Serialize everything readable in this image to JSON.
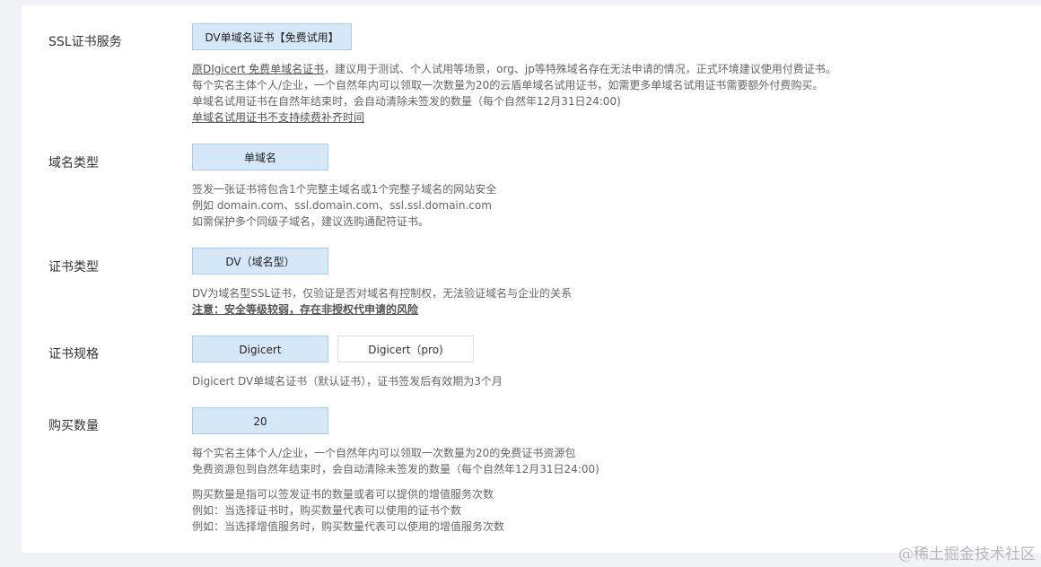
{
  "ssl": {
    "label": "SSL证书服务",
    "option": "DV单域名证书【免费试用】",
    "desc_link": "原DIgicert 免费单域名证书",
    "desc_line1_rest": "，建议用于测试、个人试用等场景，org、jp等特殊域名存在无法申请的情况，正式环境建议使用付费证书。",
    "desc_line2": "每个实名主体个人/企业，一个自然年内可以领取一次数量为20的云盾单域名试用证书，如需更多单域名试用证书需要额外付费购买。",
    "desc_line3": "单域名试用证书在自然年结束时，会自动清除未签发的数量（每个自然年12月31日24:00)",
    "desc_line4": "单域名试用证书不支持续费补齐时间"
  },
  "domain_type": {
    "label": "域名类型",
    "option": "单域名",
    "desc_lines": [
      "签发一张证书将包含1个完整主域名或1个完整子域名的网站安全",
      "例如 domain.com、ssl.domain.com、ssl.ssl.domain.com",
      "如需保护多个同级子域名，建议选购通配符证书。"
    ]
  },
  "cert_type": {
    "label": "证书类型",
    "option": "DV（域名型）",
    "desc_line1": "DV为域名型SSL证书，仅验证是否对域名有控制权，无法验证域名与企业的关系",
    "warning": "注意：安全等级较弱，存在非授权代申请的风险"
  },
  "spec": {
    "label": "证书规格",
    "options": [
      "Digicert",
      "Digicert（pro)"
    ],
    "desc_line1": "Digicert DV单域名证书（默认证书），证书签发后有效期为3个月"
  },
  "quantity": {
    "label": "购买数量",
    "value": "20",
    "desc_lines_a": [
      "每个实名主体个人/企业，一个自然年内可以领取一次数量为20的免费证书资源包",
      "免费资源包到自然年结束时，会自动清除未签发的数量（每个自然年12月31日24:00)"
    ],
    "desc_lines_b": [
      "购买数量是指可以签发证书的数量或者可以提供的增值服务次数",
      "例如：当选择证书时，购买数量代表可以使用的证书个数",
      "例如：当选择增值服务时，购买数量代表可以使用的增值服务次数"
    ]
  },
  "watermark": "@稀土掘金技术社区"
}
